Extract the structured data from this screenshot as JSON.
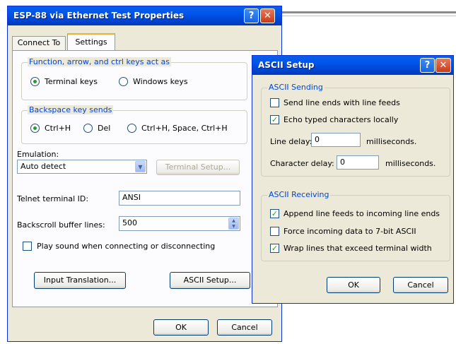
{
  "background_window": {},
  "properties": {
    "title": "ESP-88 via Ethernet Test Properties",
    "tabs": [
      "Connect To",
      "Settings"
    ],
    "group_fkeys": {
      "label": "Function, arrow, and ctrl keys act as",
      "opt1": "Terminal keys",
      "opt2": "Windows keys"
    },
    "group_backspace": {
      "label": "Backspace key sends",
      "opt1": "Ctrl+H",
      "opt2": "Del",
      "opt3": "Ctrl+H, Space, Ctrl+H"
    },
    "emulation": {
      "label": "Emulation:",
      "value": "Auto detect",
      "terminal_setup": "Terminal Setup..."
    },
    "telnet": {
      "label": "Telnet terminal ID:",
      "value": "ANSI"
    },
    "backscroll": {
      "label": "Backscroll buffer lines:",
      "value": "500"
    },
    "play_sound": "Play sound when connecting or disconnecting",
    "input_translation": "Input Translation...",
    "ascii_setup": "ASCII Setup...",
    "ok": "OK",
    "cancel": "Cancel"
  },
  "ascii": {
    "title": "ASCII Setup",
    "sending": {
      "label": "ASCII Sending",
      "send_line_ends": "Send line ends with line feeds",
      "echo": "Echo typed characters locally",
      "line_delay_label": "Line delay:",
      "line_delay_value": "0",
      "line_delay_unit": "milliseconds.",
      "char_delay_label": "Character delay:",
      "char_delay_value": "0",
      "char_delay_unit": "milliseconds."
    },
    "receiving": {
      "label": "ASCII Receiving",
      "append": "Append line feeds to incoming line ends",
      "force": "Force incoming data to 7-bit ASCII",
      "wrap": "Wrap lines that exceed terminal width"
    },
    "ok": "OK",
    "cancel": "Cancel"
  }
}
